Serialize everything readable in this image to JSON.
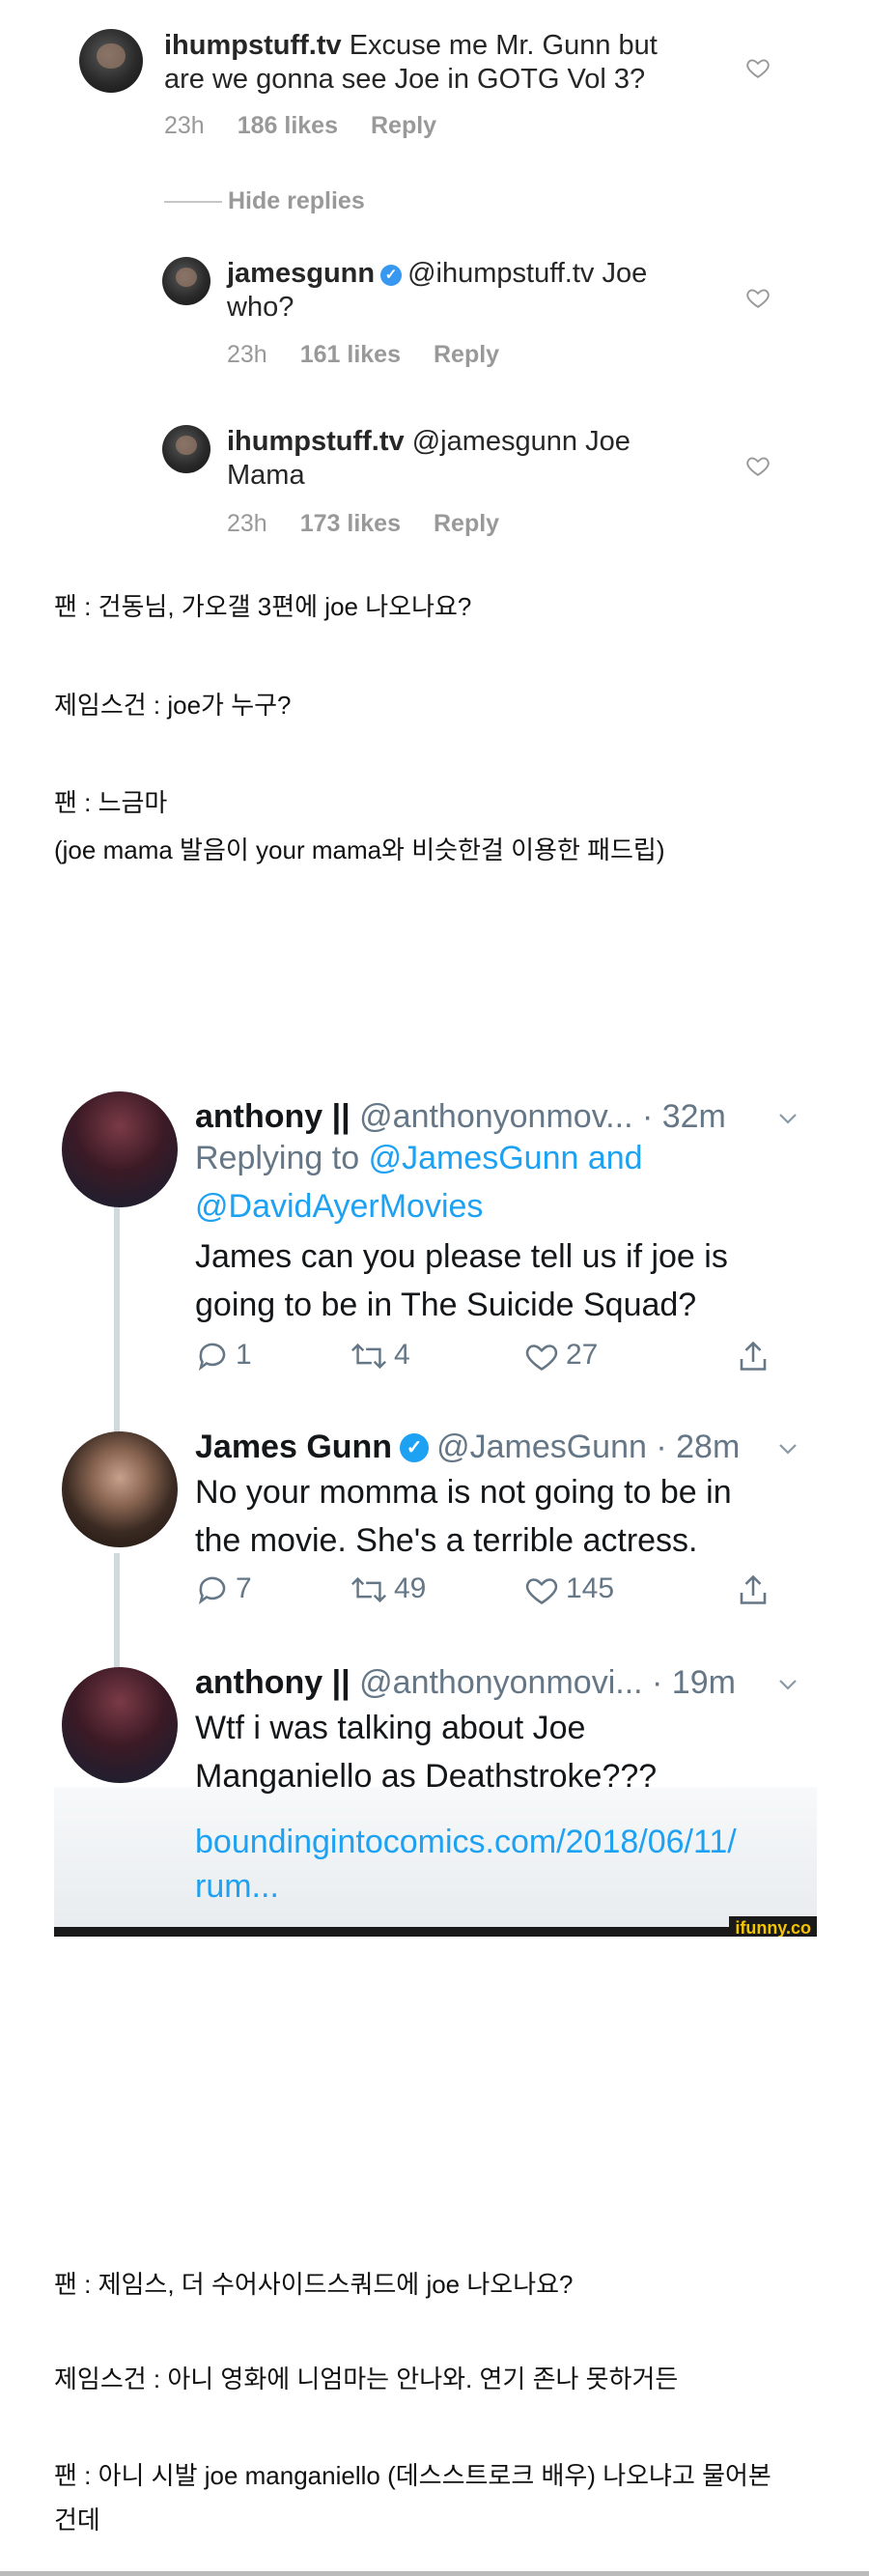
{
  "instagram": {
    "comment1": {
      "username": "ihumpstuff.tv",
      "text_line1": "Excuse me Mr. Gunn but",
      "text_line2": "are we gonna see Joe in GOTG Vol 3?",
      "time": "23h",
      "likes": "186 likes",
      "reply": "Reply"
    },
    "hide_replies": "Hide replies",
    "reply1": {
      "username": "jamesgunn",
      "mention": "@ihumpstuff.tv Joe",
      "text_line2": "who?",
      "time": "23h",
      "likes": "161 likes",
      "reply": "Reply"
    },
    "reply2": {
      "username": "ihumpstuff.tv",
      "mention": "@jamesgunn Joe",
      "text_line2": "Mama",
      "time": "23h",
      "likes": "173 likes",
      "reply": "Reply"
    },
    "icons": {
      "like": "heart-icon",
      "verified": "verified-badge-icon"
    }
  },
  "captions_top": [
    "팬 : 건동님, 가오갤 3편에 joe 나오나요?",
    "제임스건 : joe가 누구?",
    "팬 : 느금마",
    "(joe mama 발음이 your mama와 비슷한걸 이용한 패드립)"
  ],
  "twitter": {
    "tweet1": {
      "name": "anthony ||",
      "handle_time": "@anthonyonmov... · 32m",
      "replying_prefix": "Replying to",
      "replying_to1": "@JamesGunn",
      "replying_and": "and",
      "replying_to2": "@DavidAyerMovies",
      "line1": "James can you please tell us if joe is",
      "line2": "going to be in The Suicide Squad?",
      "replies": "1",
      "retweets": "4",
      "likes": "27"
    },
    "tweet2": {
      "name": "James Gunn",
      "handle_time": "@JamesGunn · 28m",
      "line1": "No your momma is not going to be in",
      "line2": "the movie. She's a terrible actress.",
      "replies": "7",
      "retweets": "49",
      "likes": "145"
    },
    "tweet3": {
      "name": "anthony ||",
      "handle_time": "@anthonyonmovi... · 19m",
      "line1": "Wtf i was talking about Joe",
      "line2": "Manganiello as Deathstroke???",
      "link_line1": "boundingintocomics.com/2018/06/11/",
      "link_line2": "rum..."
    },
    "watermark": "ifunny.co",
    "colors": {
      "link": "#1da1f2",
      "muted": "#657786",
      "text": "#14171a"
    }
  },
  "captions_bottom": [
    "팬 : 제임스, 더 수어사이드스쿼드에 joe 나오나요?",
    "제임스건 : 아니 영화에 니엄마는 안나와. 연기 존나 못하거든",
    "팬 : 아니 시발  joe manganiello (데스스트로크 배우) 나오냐고 물어본",
    "건데"
  ]
}
